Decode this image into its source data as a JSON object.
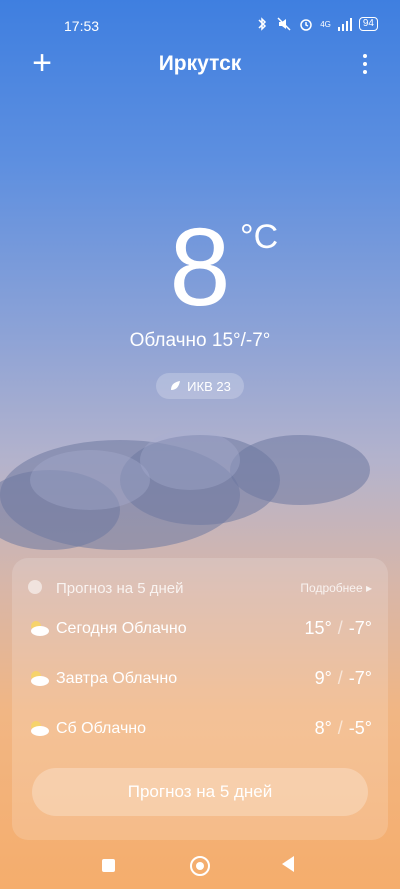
{
  "status": {
    "time": "17:53",
    "battery": "94",
    "network": "4G"
  },
  "header": {
    "city": "Иркутск"
  },
  "current": {
    "temp": "8",
    "unit": "°C",
    "condition": "Облачно  15°/-7°",
    "aqi_label": "ИКВ 23"
  },
  "forecast": {
    "title": "Прогноз на 5 дней",
    "more": "Подробнее",
    "rows": [
      {
        "day": "Сегодня  Облачно",
        "high": "15°",
        "low": "-7°"
      },
      {
        "day": "Завтра  Облачно",
        "high": "9°",
        "low": "-7°"
      },
      {
        "day": "Сб  Облачно",
        "high": "8°",
        "low": "-5°"
      }
    ],
    "button": "Прогноз на 5 дней"
  }
}
